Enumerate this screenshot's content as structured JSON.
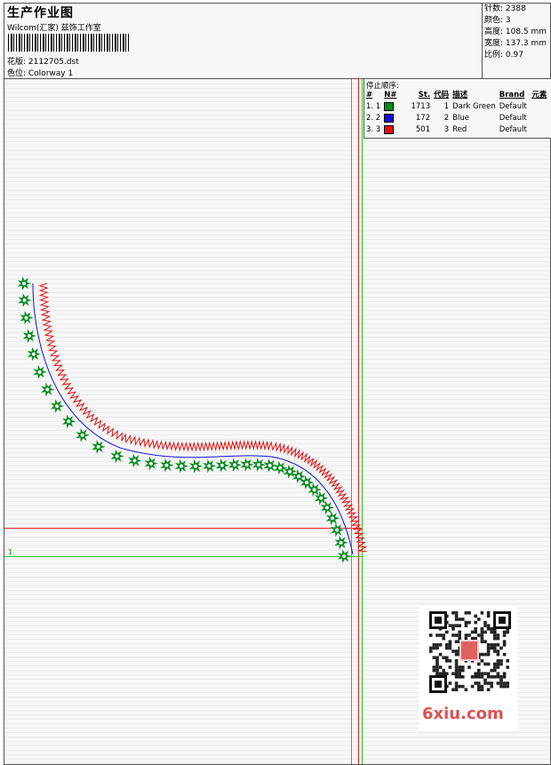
{
  "header": {
    "title": "生产作业图",
    "company": "Wilcom(汇家) 兹饰工作室",
    "pattern": "花版: 2112705.dst",
    "colorway": "色位: Colorway 1"
  },
  "stats": {
    "stitches": "针数: 2388",
    "colors": "颜色: 3",
    "height": "高度: 108.5 mm",
    "width": "宽度: 137.3 mm",
    "scale": "比例: 0.97"
  },
  "stop_sequence": {
    "title": "停止顺序:",
    "headers": [
      "#",
      "N#",
      "St.",
      "代码",
      "描述",
      "Brand",
      "元素"
    ],
    "rows": [
      {
        "idx": "1. 1",
        "color": "#008c1e",
        "st": "1713",
        "code": "1",
        "desc": "Dark Green",
        "brand": "Default"
      },
      {
        "idx": "2. 2",
        "color": "#1010e0",
        "st": "172",
        "code": "2",
        "desc": "Blue",
        "brand": "Default"
      },
      {
        "idx": "3. 3",
        "color": "#e01010",
        "st": "501",
        "code": "3",
        "desc": "Red",
        "brand": "Default"
      }
    ]
  },
  "origin_label": "1",
  "watermark": "6xiu.com",
  "colors": {
    "green": "#008c1e",
    "blue": "#1010e0",
    "red": "#e01010",
    "guide_green": "#22cc22",
    "guide_red": "#ee2222"
  }
}
